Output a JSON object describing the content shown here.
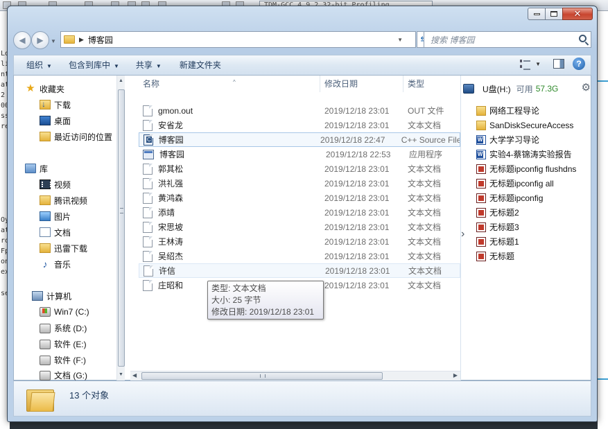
{
  "background": {
    "editor_tab_title": "TDM-GCC 4.9.2 32-bit Profiling",
    "left_code_fragments": [
      "Lo",
      "li",
      "nt",
      "at",
      "2",
      "00",
      "ss",
      "re",
      "",
      "",
      "",
      "",
      "Oy",
      "at",
      "ro",
      "Fp",
      "on",
      "ex",
      "",
      "se"
    ]
  },
  "window": {
    "controls": {
      "minimize": "—",
      "maximize": "□",
      "close": "✕"
    }
  },
  "address": {
    "crumb": "博客园",
    "search_placeholder": "搜索 博客园"
  },
  "toolbar": {
    "organize": "组织",
    "include_in_library": "包含到库中",
    "share": "共享",
    "new_folder": "新建文件夹"
  },
  "nav": {
    "favorites": "收藏夹",
    "downloads": "下载",
    "desktop": "桌面",
    "recent": "最近访问的位置",
    "libraries": "库",
    "videos": "视频",
    "tencent_video": "腾讯视频",
    "pictures": "图片",
    "documents": "文档",
    "thunder": "迅雷下载",
    "music": "音乐",
    "computer": "计算机",
    "drives": [
      "Win7 (C:)",
      "系统 (D:)",
      "软件 (E:)",
      "软件 (F:)",
      "文档 (G:)"
    ]
  },
  "columns": {
    "name": "名称",
    "date": "修改日期",
    "type": "类型"
  },
  "files": [
    {
      "name": "gmon.out",
      "date": "2019/12/18 23:01",
      "type": "OUT 文件",
      "icon": "file-icon"
    },
    {
      "name": "安省龙",
      "date": "2019/12/18 23:01",
      "type": "文本文档",
      "icon": "text-file-icon"
    },
    {
      "name": "博客园",
      "date": "2019/12/18 22:47",
      "type": "C++ Source File",
      "icon": "cpp-file-icon"
    },
    {
      "name": "博客园",
      "date": "2019/12/18 22:53",
      "type": "应用程序",
      "icon": "exe-file-icon"
    },
    {
      "name": "郭其松",
      "date": "2019/12/18 23:01",
      "type": "文本文档",
      "icon": "text-file-icon"
    },
    {
      "name": "洪礼强",
      "date": "2019/12/18 23:01",
      "type": "文本文档",
      "icon": "text-file-icon"
    },
    {
      "name": "黄鸿森",
      "date": "2019/12/18 23:01",
      "type": "文本文档",
      "icon": "text-file-icon"
    },
    {
      "name": "添靖",
      "date": "2019/12/18 23:01",
      "type": "文本文档",
      "icon": "text-file-icon"
    },
    {
      "name": "宋思坡",
      "date": "2019/12/18 23:01",
      "type": "文本文档",
      "icon": "text-file-icon"
    },
    {
      "name": "王林涛",
      "date": "2019/12/18 23:01",
      "type": "文本文档",
      "icon": "text-file-icon"
    },
    {
      "name": "吴绍杰",
      "date": "2019/12/18 23:01",
      "type": "文本文档",
      "icon": "text-file-icon"
    },
    {
      "name": "许信",
      "date": "2019/12/18 23:01",
      "type": "文本文档",
      "icon": "text-file-icon"
    },
    {
      "name": "庄昭和",
      "date": "2019/12/18 23:01",
      "type": "文本文档",
      "icon": "text-file-icon"
    }
  ],
  "tooltip": {
    "type": "类型: 文本文档",
    "size": "大小: 25 字节",
    "modified": "修改日期: 2019/12/18 23:01"
  },
  "preview": {
    "drive_name": "U盘(H:)",
    "free_label": "可用",
    "free_value": "57.3G",
    "items": [
      {
        "label": "网络工程导论",
        "icon": "folder-icon"
      },
      {
        "label": "SanDiskSecureAccess",
        "icon": "folder-icon"
      },
      {
        "label": "大学学习导论",
        "icon": "word-doc-icon"
      },
      {
        "label": "实验4-蔡锦涛实验报告",
        "icon": "word-doc-icon"
      },
      {
        "label": "无标题ipconfig flushdns",
        "icon": "screenshot-icon"
      },
      {
        "label": "无标题ipconfig all",
        "icon": "screenshot-icon"
      },
      {
        "label": "无标题ipconfig",
        "icon": "screenshot-icon"
      },
      {
        "label": "无标题2",
        "icon": "screenshot-icon"
      },
      {
        "label": "无标题3",
        "icon": "screenshot-icon"
      },
      {
        "label": "无标题1",
        "icon": "screenshot-icon"
      },
      {
        "label": "无标题",
        "icon": "screenshot-icon"
      }
    ]
  },
  "status": {
    "count": "13 个对象"
  }
}
